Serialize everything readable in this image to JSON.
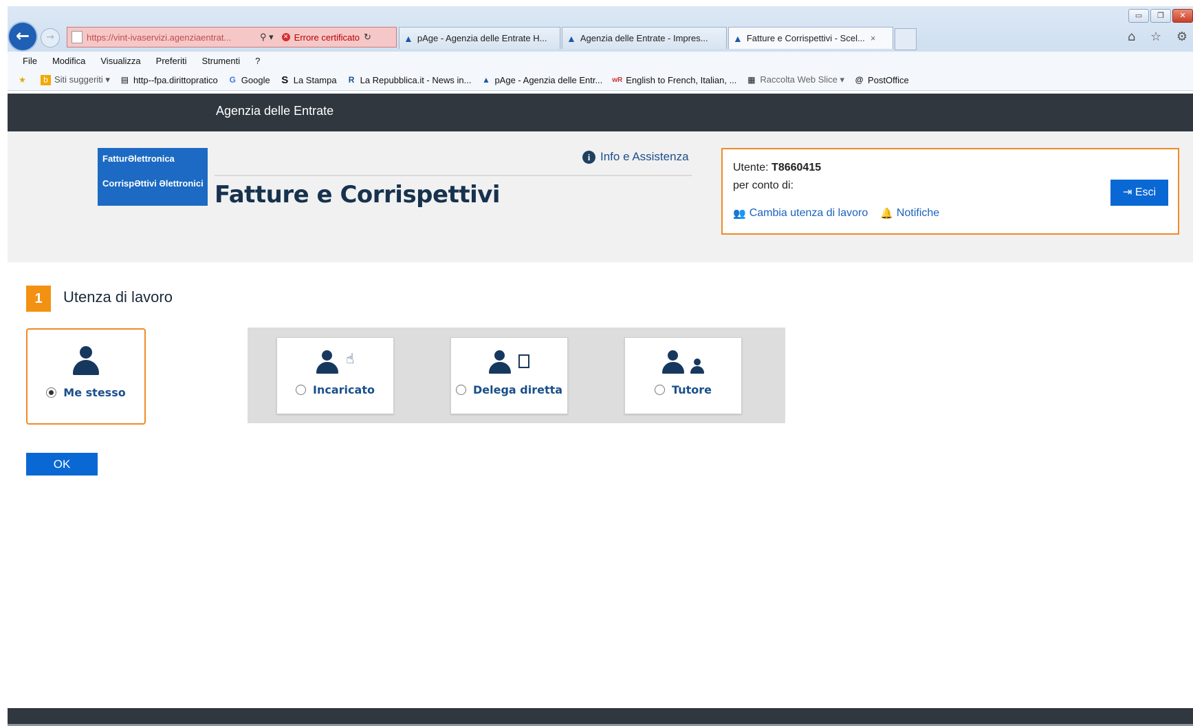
{
  "browser": {
    "window_buttons": [
      "▭",
      "❐",
      "✕"
    ],
    "address": {
      "url": "https://vint-ivaservizi.agenziaentrat...",
      "search_glyph": "⚲ ▾",
      "cert_error": "Errore certificato",
      "refresh": "↻"
    },
    "tabs": [
      {
        "label": "pAge - Agenzia delle Entrate H..."
      },
      {
        "label": "Agenzia delle Entrate - Impres..."
      },
      {
        "label": "Fatture e Corrispettivi - Scel...",
        "close": "×"
      }
    ],
    "right_icons": "⌂ ☆ ⚙",
    "menu": [
      "File",
      "Modifica",
      "Visualizza",
      "Preferiti",
      "Strumenti",
      "?"
    ],
    "favorites": [
      {
        "label": "",
        "icon": "favorites-star-icon",
        "glyph": "★"
      },
      {
        "label": "Siti suggeriti ▾",
        "icon": "bing-icon",
        "glyph": "b"
      },
      {
        "label": "http--fpa.dirittopratico",
        "icon": "page-icon",
        "glyph": "▤"
      },
      {
        "label": "Google",
        "icon": "google-icon",
        "glyph": "G"
      },
      {
        "label": "La Stampa",
        "icon": "la-stampa-icon",
        "glyph": "S"
      },
      {
        "label": "La Repubblica.it - News in...",
        "icon": "repubblica-icon",
        "glyph": "R"
      },
      {
        "label": "pAge - Agenzia delle Entr...",
        "icon": "page-icon",
        "glyph": "▲"
      },
      {
        "label": "English to French, Italian, ...",
        "icon": "wordreference-icon",
        "glyph": "wR"
      },
      {
        "label": "Raccolta Web Slice ▾",
        "icon": "web-slice-icon",
        "glyph": "▦"
      },
      {
        "label": "PostOffice",
        "icon": "postoffice-icon",
        "glyph": "@"
      }
    ]
  },
  "site": {
    "topbar_title": "Agenzia delle Entrate",
    "logo": {
      "line1": "FatturƏlettronica",
      "line2": "CorrispƏttivi Əlettronici"
    },
    "app_title": "Fatture e Corrispettivi",
    "info_link": "Info e Assistenza",
    "user": {
      "utente_label": "Utente:",
      "utente_value": "T8660415",
      "per_conto": "per conto di:",
      "cambia": "Cambia utenza di lavoro",
      "notifiche": "Notifiche",
      "esci": "Esci"
    }
  },
  "step": {
    "number": "1",
    "title": "Utenza di lavoro"
  },
  "options": [
    {
      "label": "Me stesso",
      "selected": true,
      "icon": "user-icon"
    },
    {
      "label": "Incaricato",
      "selected": false,
      "icon": "user-hand-icon"
    },
    {
      "label": "Delega diretta",
      "selected": false,
      "icon": "user-document-icon"
    },
    {
      "label": "Tutore",
      "selected": false,
      "icon": "user-group-icon"
    }
  ],
  "ok_label": "OK",
  "colors": {
    "accent_orange": "#f08a24",
    "primary_blue": "#0a68d4",
    "dark_bar": "#30373f",
    "icon_navy": "#17385e"
  }
}
